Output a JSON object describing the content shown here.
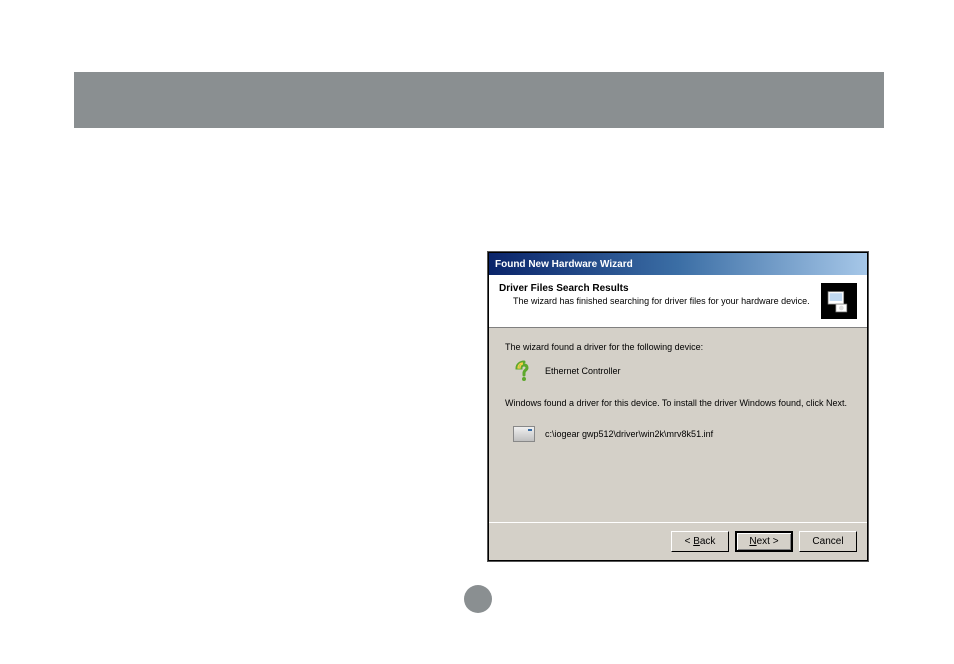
{
  "dialog": {
    "title": "Found New Hardware Wizard",
    "header": {
      "title": "Driver Files Search Results",
      "subtitle": "The wizard has finished searching for driver files for your hardware device."
    },
    "body": {
      "found_line": "The wizard found a driver for the following device:",
      "device_name": "Ethernet Controller",
      "install_line": "Windows found a driver for this device. To install the driver Windows found, click Next.",
      "driver_path": "c:\\iogear gwp512\\driver\\win2k\\mrv8k51.inf"
    },
    "buttons": {
      "back": "< Back",
      "next": "Next >",
      "cancel": "Cancel"
    }
  }
}
